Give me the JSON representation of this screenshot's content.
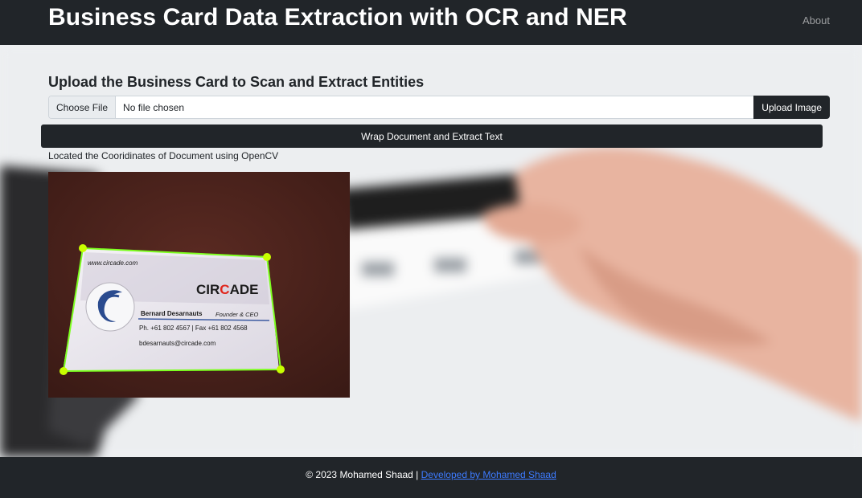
{
  "navbar": {
    "brand": "Business Card Data Extraction with OCR and NER",
    "about": "About"
  },
  "upload": {
    "heading": "Upload the Business Card to Scan and Extract Entities",
    "choose_file": "Choose File",
    "file_status": "No file chosen",
    "upload_button": "Upload Image"
  },
  "wrap_button": "Wrap Document and Extract Text",
  "located_text": "Located the Cooridinates of Document using OpenCV",
  "card": {
    "website": "www.circade.com",
    "company_prefix": "CIR",
    "company_accent": "C",
    "company_suffix": "ADE",
    "name": "Bernard Desarnauts",
    "title": "Founder & CEO",
    "phone": "Ph. +61 802 4567 | Fax +61 802 4568",
    "email": "bdesarnauts@circade.com"
  },
  "footer": {
    "copyright": "© 2023 Mohamed Shaad | ",
    "link": "Developed by Mohamed Shaad"
  },
  "colors": {
    "dark": "#212529",
    "contour": "#7dff1f",
    "corner": "#c8ff00",
    "link": "#3d7bff",
    "card_accent": "#e0251b"
  }
}
